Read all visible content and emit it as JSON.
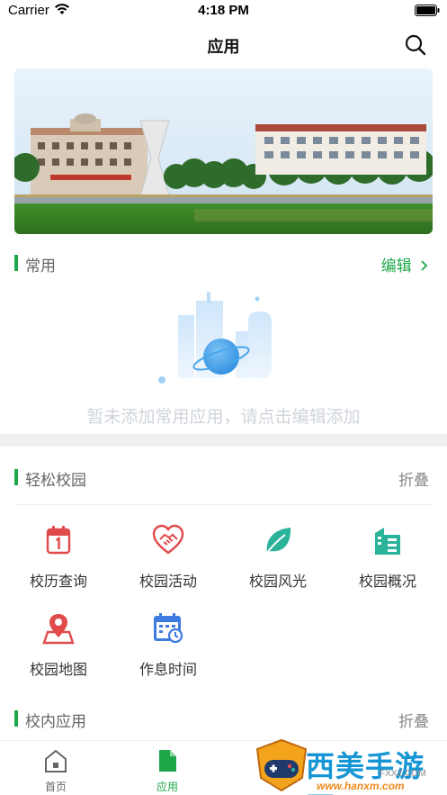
{
  "status_bar": {
    "carrier": "Carrier",
    "time": "4:18 PM"
  },
  "nav": {
    "title": "应用"
  },
  "common_section": {
    "title": "常用",
    "action": "编辑",
    "empty_text": "暂未添加常用应用，请点击编辑添加"
  },
  "campus_section": {
    "title": "轻松校园",
    "action": "折叠",
    "apps": [
      {
        "label": "校历查询",
        "icon": "calendar-icon",
        "color": "#e04a4a"
      },
      {
        "label": "校园活动",
        "icon": "heart-handshake-icon",
        "color": "#e04a4a"
      },
      {
        "label": "校园风光",
        "icon": "leaf-icon",
        "color": "#2bb39a"
      },
      {
        "label": "校园概况",
        "icon": "building-icon",
        "color": "#2bb39a"
      },
      {
        "label": "校园地图",
        "icon": "map-pin-icon",
        "color": "#e04a4a"
      },
      {
        "label": "作息时间",
        "icon": "schedule-icon",
        "color": "#3d7be0"
      }
    ]
  },
  "inner_section": {
    "title": "校内应用",
    "action": "折叠"
  },
  "tabs": [
    {
      "label": "首页",
      "icon": "home-icon",
      "active": false
    },
    {
      "label": "应用",
      "icon": "apps-icon",
      "active": true
    }
  ],
  "watermark": {
    "text": "西美手游网",
    "url": "www.hanxm.com",
    "small": "FXXZ.COM"
  },
  "colors": {
    "accent": "#1ea84a",
    "section_title": "#666666",
    "empty_text": "#cfd4da"
  }
}
